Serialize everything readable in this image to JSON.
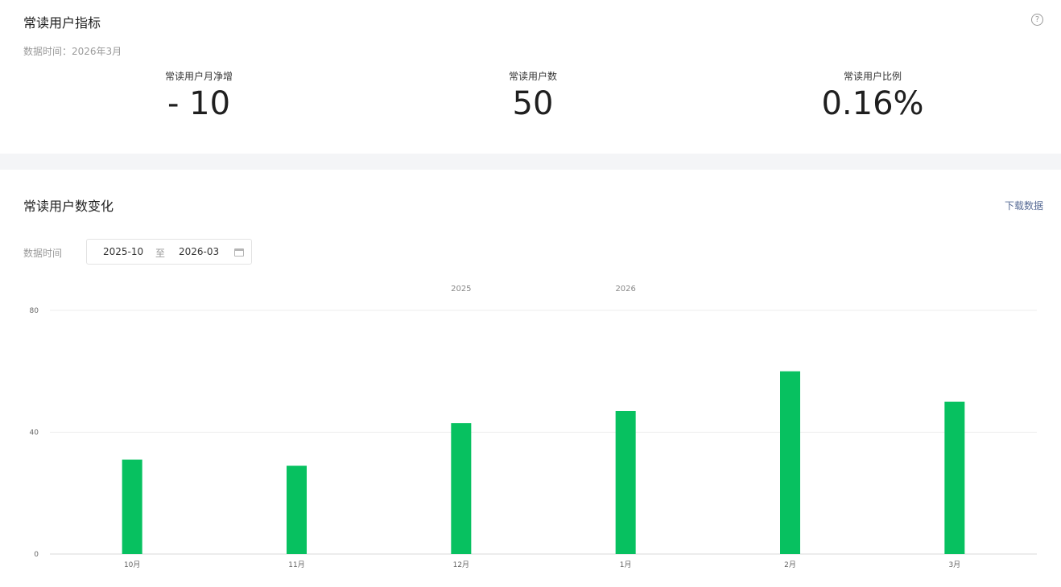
{
  "metrics_section": {
    "title": "常读用户指标",
    "data_time": "数据时间：2026年3月",
    "help_icon": "question-circle-icon",
    "items": [
      {
        "label": "常读用户月净增",
        "value": "- 10"
      },
      {
        "label": "常读用户数",
        "value": "50"
      },
      {
        "label": "常读用户比例",
        "value": "0.16%"
      }
    ]
  },
  "trend_section": {
    "title": "常读用户数变化",
    "download_label": "下载数据",
    "date_filter": {
      "label": "数据时间",
      "start": "2025-10",
      "separator": "至",
      "end": "2026-03",
      "icon": "calendar-icon"
    }
  },
  "colors": {
    "bar": "#07c160",
    "link": "#576b95",
    "band": "#f4f5f7"
  },
  "chart_data": {
    "type": "bar",
    "year_labels": [
      {
        "text": "2025",
        "category_index": 2
      },
      {
        "text": "2026",
        "category_index": 3
      }
    ],
    "categories": [
      "10月",
      "11月",
      "12月",
      "1月",
      "2月",
      "3月"
    ],
    "values": [
      31,
      29,
      43,
      47,
      60,
      50
    ],
    "yticks": [
      "80",
      "40",
      "0"
    ],
    "ylim": [
      0,
      80
    ],
    "grid": true
  }
}
